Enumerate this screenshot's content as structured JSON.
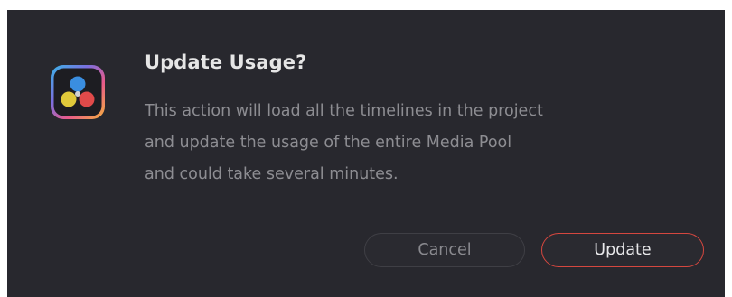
{
  "dialog": {
    "title": "Update Usage?",
    "message_lines": [
      "This action will load all the timelines in the project",
      "and update the usage of the entire Media Pool",
      "and could take several minutes."
    ],
    "icon": "davinci-resolve-app-icon"
  },
  "buttons": {
    "cancel_label": "Cancel",
    "update_label": "Update"
  },
  "colors": {
    "dialog_background": "#28282e",
    "title_text": "#e6e6e6",
    "body_text": "#8d8d92",
    "update_border": "#d5473f",
    "cancel_border": "#3f3f45"
  }
}
